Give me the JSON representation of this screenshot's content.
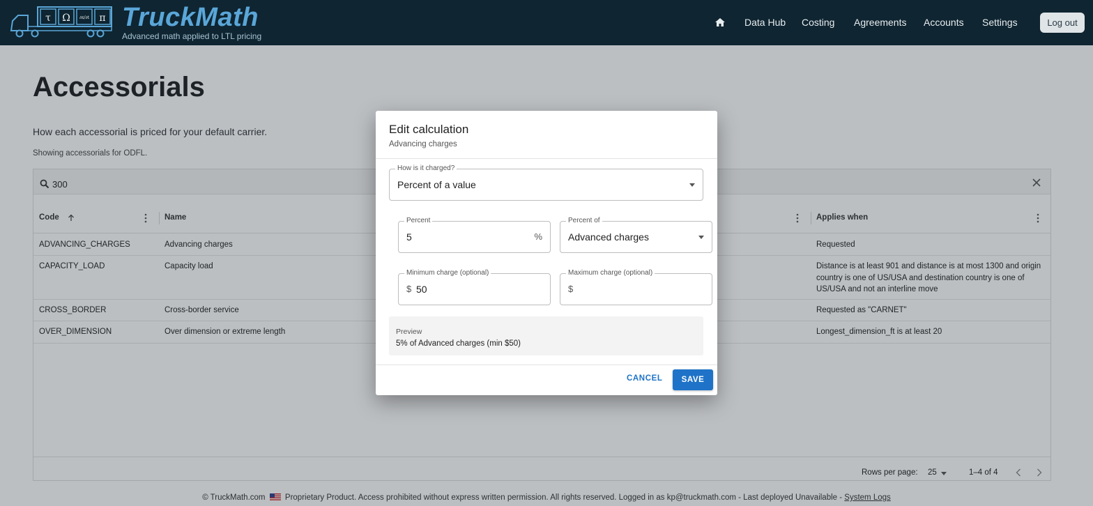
{
  "header": {
    "brand": "TruckMath",
    "tagline": "Advanced math applied to LTL pricing",
    "logo_symbols": [
      "τ",
      "Ω",
      "∂x/∂t",
      "π"
    ],
    "nav": [
      "Data Hub",
      "Costing",
      "Agreements",
      "Accounts",
      "Settings"
    ],
    "logout_label": "Log out",
    "home_icon": "home-icon"
  },
  "page": {
    "title": "Accessorials",
    "description": "How each accessorial is priced for your default carrier.",
    "note": "Showing accessorials for ODFL."
  },
  "grid": {
    "search_value": "300",
    "columns": {
      "code": "Code",
      "name": "Name",
      "applies_when": "Applies when"
    },
    "rows": [
      {
        "code": "ADVANCING_CHARGES",
        "name": "Advancing charges",
        "applies_when": "Requested"
      },
      {
        "code": "CAPACITY_LOAD",
        "name": "Capacity load",
        "applies_when": "Distance is at least 901 and distance is at most 1300 and origin country is one of US/USA and destination country is one of US/USA and not an interline move"
      },
      {
        "code": "CROSS_BORDER",
        "name": "Cross-border service",
        "applies_when": "Requested as \"CARNET\""
      },
      {
        "code": "OVER_DIMENSION",
        "name": "Over dimension or extreme length",
        "applies_when": "Longest_dimension_ft is at least 20"
      }
    ],
    "footer": {
      "rows_per_page_label": "Rows per page:",
      "rows_per_page": "25",
      "range": "1–4 of 4"
    }
  },
  "footer": {
    "copyright": "© TruckMath.com",
    "text": "Proprietary Product. Access prohibited without express written permission. All rights reserved. Logged in as kp@truckmath.com - Last deployed Unavailable -",
    "link": "System Logs"
  },
  "dialog": {
    "title": "Edit calculation",
    "subtitle": "Advancing charges",
    "charge_method": {
      "label": "How is it charged?",
      "value": "Percent of a value"
    },
    "percent": {
      "label": "Percent",
      "value": "5",
      "suffix": "%"
    },
    "percent_of": {
      "label": "Percent of",
      "value": "Advanced charges"
    },
    "min_charge": {
      "label": "Minimum charge (optional)",
      "prefix": "$",
      "value": "50"
    },
    "max_charge": {
      "label": "Maximum charge (optional)",
      "prefix": "$",
      "value": ""
    },
    "preview": {
      "label": "Preview",
      "text": "5% of Advanced charges (min $50)"
    },
    "cancel_label": "CANCEL",
    "save_label": "SAVE"
  },
  "colors": {
    "header_bg": "#0f2531",
    "brand": "#5aa6d8",
    "primary": "#1e73c8"
  }
}
